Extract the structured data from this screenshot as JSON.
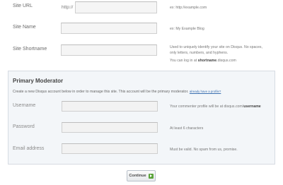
{
  "site_url": {
    "label": "Site URL",
    "prefix": "http://",
    "value": "",
    "help": "ex: http://example.com"
  },
  "site_name": {
    "label": "Site Name",
    "value": "",
    "help": "ex: My Example Blog"
  },
  "site_shortname": {
    "label": "Site Shortname",
    "value": "",
    "help_lines": [
      "Used to uniquely identify your site on Disqus. No spaces,",
      "only letters, numbers, and hyphens."
    ],
    "login_prefix": "You can log in at ",
    "login_bold": "shortname",
    "login_suffix": ".disqus.com"
  },
  "moderator": {
    "title": "Primary Moderator",
    "description": "Create a new Disqus account below in order to manage this site. This account will be the primary moderator.",
    "link": "already have a profile?",
    "username": {
      "label": "Username",
      "value": "",
      "help_prefix": "Your commenter profile will be at disqus.com/",
      "help_bold": "username"
    },
    "password": {
      "label": "Password",
      "value": "",
      "help": "At least 6 characters"
    },
    "email": {
      "label": "Email address",
      "value": "",
      "help": "Must be valid. No spam from us, promise."
    }
  },
  "continue_label": "Continue",
  "colors": {
    "panel_bg": "#f3f6f9",
    "link": "#3a6fb0",
    "arrow": "#5aa33a"
  }
}
